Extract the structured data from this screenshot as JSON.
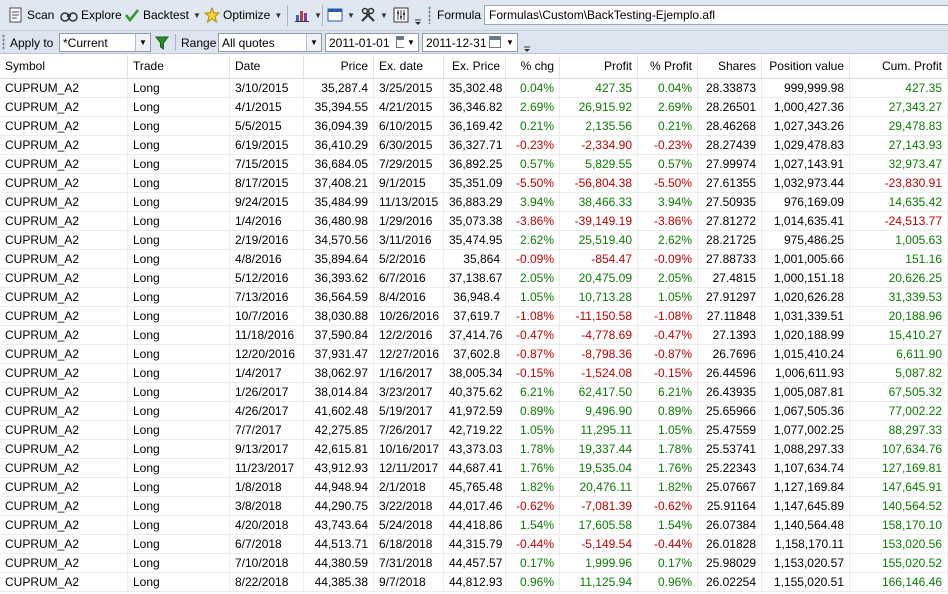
{
  "toolbar": {
    "scan": "Scan",
    "explore": "Explore",
    "backtest": "Backtest",
    "optimize": "Optimize",
    "formula_label": "Formula",
    "formula_path": "Formulas\\Custom\\BackTesting-Ejemplo.afl"
  },
  "filter": {
    "apply_to_label": "Apply to",
    "apply_to_value": "*Current",
    "range_label": "Range",
    "range_value": "All quotes",
    "date_from": "2011-01-01",
    "date_to": "2011-12-31"
  },
  "colors": {
    "positive": "#0a7d00",
    "negative": "#c00000",
    "toolbar": "#dfe7f1"
  },
  "table": {
    "columns": [
      "Symbol",
      "Trade",
      "Date",
      "Price",
      "Ex. date",
      "Ex. Price",
      "% chg",
      "Profit",
      "% Profit",
      "Shares",
      "Position value",
      "Cum. Profit"
    ],
    "rows": [
      [
        "CUPRUM_A2",
        "Long",
        "3/10/2015",
        "35,287.4",
        "3/25/2015",
        "35,302.48",
        "0.04%",
        "427.35",
        "0.04%",
        "28.33873",
        "999,999.98",
        "427.35"
      ],
      [
        "CUPRUM_A2",
        "Long",
        "4/1/2015",
        "35,394.55",
        "4/21/2015",
        "36,346.82",
        "2.69%",
        "26,915.92",
        "2.69%",
        "28.26501",
        "1,000,427.36",
        "27,343.27"
      ],
      [
        "CUPRUM_A2",
        "Long",
        "5/5/2015",
        "36,094.39",
        "6/10/2015",
        "36,169.42",
        "0.21%",
        "2,135.56",
        "0.21%",
        "28.46268",
        "1,027,343.26",
        "29,478.83"
      ],
      [
        "CUPRUM_A2",
        "Long",
        "6/19/2015",
        "36,410.29",
        "6/30/2015",
        "36,327.71",
        "-0.23%",
        "-2,334.90",
        "-0.23%",
        "28.27439",
        "1,029,478.83",
        "27,143.93"
      ],
      [
        "CUPRUM_A2",
        "Long",
        "7/15/2015",
        "36,684.05",
        "7/29/2015",
        "36,892.25",
        "0.57%",
        "5,829.55",
        "0.57%",
        "27.99974",
        "1,027,143.91",
        "32,973.47"
      ],
      [
        "CUPRUM_A2",
        "Long",
        "8/17/2015",
        "37,408.21",
        "9/1/2015",
        "35,351.09",
        "-5.50%",
        "-56,804.38",
        "-5.50%",
        "27.61355",
        "1,032,973.44",
        "-23,830.91"
      ],
      [
        "CUPRUM_A2",
        "Long",
        "9/24/2015",
        "35,484.99",
        "11/13/2015",
        "36,883.29",
        "3.94%",
        "38,466.33",
        "3.94%",
        "27.50935",
        "976,169.09",
        "14,635.42"
      ],
      [
        "CUPRUM_A2",
        "Long",
        "1/4/2016",
        "36,480.98",
        "1/29/2016",
        "35,073.38",
        "-3.86%",
        "-39,149.19",
        "-3.86%",
        "27.81272",
        "1,014,635.41",
        "-24,513.77"
      ],
      [
        "CUPRUM_A2",
        "Long",
        "2/19/2016",
        "34,570.56",
        "3/11/2016",
        "35,474.95",
        "2.62%",
        "25,519.40",
        "2.62%",
        "28.21725",
        "975,486.25",
        "1,005.63"
      ],
      [
        "CUPRUM_A2",
        "Long",
        "4/8/2016",
        "35,894.64",
        "5/2/2016",
        "35,864",
        "-0.09%",
        "-854.47",
        "-0.09%",
        "27.88733",
        "1,001,005.66",
        "151.16"
      ],
      [
        "CUPRUM_A2",
        "Long",
        "5/12/2016",
        "36,393.62",
        "6/7/2016",
        "37,138.67",
        "2.05%",
        "20,475.09",
        "2.05%",
        "27.4815",
        "1,000,151.18",
        "20,626.25"
      ],
      [
        "CUPRUM_A2",
        "Long",
        "7/13/2016",
        "36,564.59",
        "8/4/2016",
        "36,948.4",
        "1.05%",
        "10,713.28",
        "1.05%",
        "27.91297",
        "1,020,626.28",
        "31,339.53"
      ],
      [
        "CUPRUM_A2",
        "Long",
        "10/7/2016",
        "38,030.88",
        "10/26/2016",
        "37,619.7",
        "-1.08%",
        "-11,150.58",
        "-1.08%",
        "27.11848",
        "1,031,339.51",
        "20,188.96"
      ],
      [
        "CUPRUM_A2",
        "Long",
        "11/18/2016",
        "37,590.84",
        "12/2/2016",
        "37,414.76",
        "-0.47%",
        "-4,778.69",
        "-0.47%",
        "27.1393",
        "1,020,188.99",
        "15,410.27"
      ],
      [
        "CUPRUM_A2",
        "Long",
        "12/20/2016",
        "37,931.47",
        "12/27/2016",
        "37,602.8",
        "-0.87%",
        "-8,798.36",
        "-0.87%",
        "26.7696",
        "1,015,410.24",
        "6,611.90"
      ],
      [
        "CUPRUM_A2",
        "Long",
        "1/4/2017",
        "38,062.97",
        "1/16/2017",
        "38,005.34",
        "-0.15%",
        "-1,524.08",
        "-0.15%",
        "26.44596",
        "1,006,611.93",
        "5,087.82"
      ],
      [
        "CUPRUM_A2",
        "Long",
        "1/26/2017",
        "38,014.84",
        "3/23/2017",
        "40,375.62",
        "6.21%",
        "62,417.50",
        "6.21%",
        "26.43935",
        "1,005,087.81",
        "67,505.32"
      ],
      [
        "CUPRUM_A2",
        "Long",
        "4/26/2017",
        "41,602.48",
        "5/19/2017",
        "41,972.59",
        "0.89%",
        "9,496.90",
        "0.89%",
        "25.65966",
        "1,067,505.36",
        "77,002.22"
      ],
      [
        "CUPRUM_A2",
        "Long",
        "7/7/2017",
        "42,275.85",
        "7/26/2017",
        "42,719.22",
        "1.05%",
        "11,295.11",
        "1.05%",
        "25.47559",
        "1,077,002.25",
        "88,297.33"
      ],
      [
        "CUPRUM_A2",
        "Long",
        "9/13/2017",
        "42,615.81",
        "10/16/2017",
        "43,373.03",
        "1.78%",
        "19,337.44",
        "1.78%",
        "25.53741",
        "1,088,297.33",
        "107,634.76"
      ],
      [
        "CUPRUM_A2",
        "Long",
        "11/23/2017",
        "43,912.93",
        "12/11/2017",
        "44,687.41",
        "1.76%",
        "19,535.04",
        "1.76%",
        "25.22343",
        "1,107,634.74",
        "127,169.81"
      ],
      [
        "CUPRUM_A2",
        "Long",
        "1/8/2018",
        "44,948.94",
        "2/1/2018",
        "45,765.48",
        "1.82%",
        "20,476.11",
        "1.82%",
        "25.07667",
        "1,127,169.84",
        "147,645.91"
      ],
      [
        "CUPRUM_A2",
        "Long",
        "3/8/2018",
        "44,290.75",
        "3/22/2018",
        "44,017.46",
        "-0.62%",
        "-7,081.39",
        "-0.62%",
        "25.91164",
        "1,147,645.89",
        "140,564.52"
      ],
      [
        "CUPRUM_A2",
        "Long",
        "4/20/2018",
        "43,743.64",
        "5/24/2018",
        "44,418.86",
        "1.54%",
        "17,605.58",
        "1.54%",
        "26.07384",
        "1,140,564.48",
        "158,170.10"
      ],
      [
        "CUPRUM_A2",
        "Long",
        "6/7/2018",
        "44,513.71",
        "6/18/2018",
        "44,315.79",
        "-0.44%",
        "-5,149.54",
        "-0.44%",
        "26.01828",
        "1,158,170.11",
        "153,020.56"
      ],
      [
        "CUPRUM_A2",
        "Long",
        "7/10/2018",
        "44,380.59",
        "7/31/2018",
        "44,457.57",
        "0.17%",
        "1,999.96",
        "0.17%",
        "25.98029",
        "1,153,020.57",
        "155,020.52"
      ],
      [
        "CUPRUM_A2",
        "Long",
        "8/22/2018",
        "44,385.38",
        "9/7/2018",
        "44,812.93",
        "0.96%",
        "11,125.94",
        "0.96%",
        "26.02254",
        "1,155,020.51",
        "166,146.46"
      ]
    ]
  }
}
